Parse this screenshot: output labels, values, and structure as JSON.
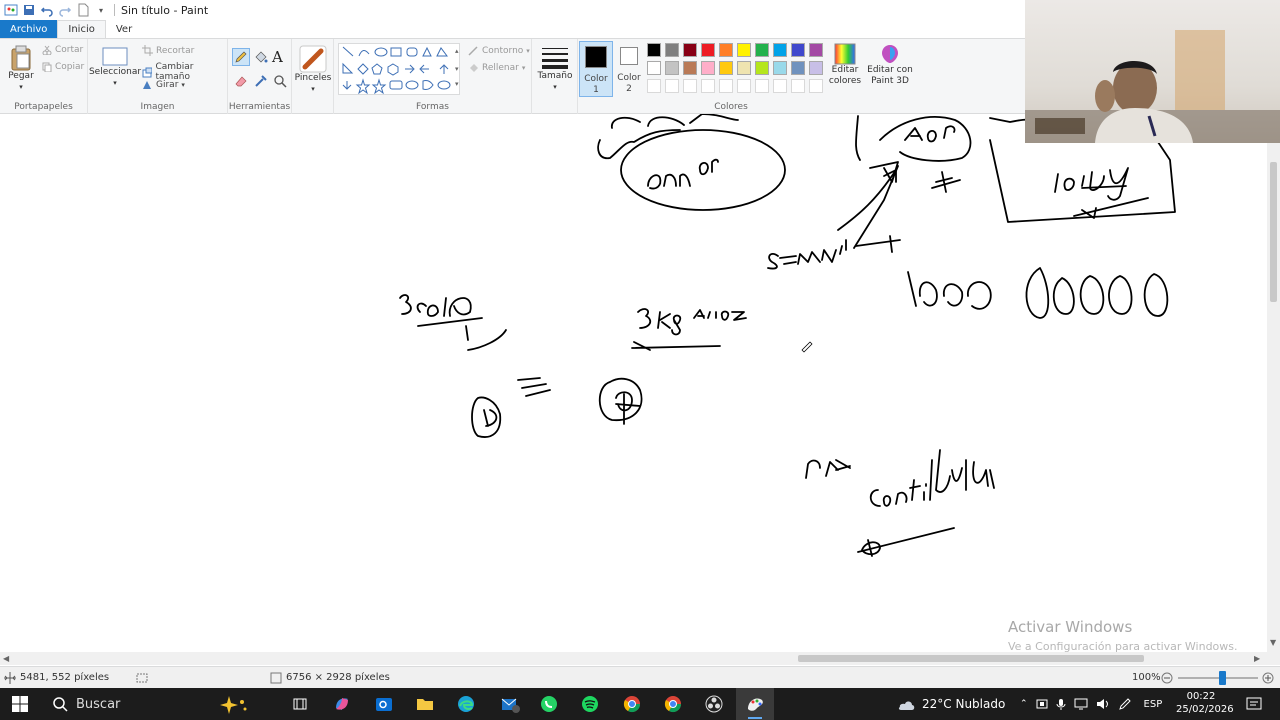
{
  "window": {
    "title": "Sin título - Paint"
  },
  "tabs": [
    {
      "label": "Archivo"
    },
    {
      "label": "Inicio"
    },
    {
      "label": "Ver"
    }
  ],
  "ribbon": {
    "clipboard": {
      "title": "Portapapeles",
      "paste": "Pegar",
      "cut": "Cortar",
      "copy": "Copiar"
    },
    "image": {
      "title": "Imagen",
      "select": "Seleccionar",
      "crop": "Recortar",
      "resize": "Cambiar tamaño",
      "rotate": "Girar"
    },
    "tools": {
      "title": "Herramientas"
    },
    "brushes": {
      "label": "Pinceles"
    },
    "shapes": {
      "title": "Formas",
      "outline": "Contorno",
      "fill": "Rellenar"
    },
    "size": {
      "label": "Tamaño"
    },
    "color1": {
      "label": "Color",
      "sub": "1"
    },
    "color2": {
      "label": "Color",
      "sub": "2"
    },
    "colors": {
      "title": "Colores",
      "edit": "Editar colores",
      "paint3d": "Editar con Paint 3D",
      "row1": [
        "#000000",
        "#7f7f7f",
        "#880015",
        "#ed1c24",
        "#ff7f27",
        "#fff200",
        "#22b14c",
        "#00a2e8",
        "#3f48cc",
        "#a349a4"
      ],
      "row2": [
        "#ffffff",
        "#c3c3c3",
        "#b97a57",
        "#ffaec9",
        "#ffc90e",
        "#efe4b0",
        "#b5e61d",
        "#99d9ea",
        "#7092be",
        "#c8bfe7"
      ]
    }
  },
  "canvas": {
    "watermark_title": "Activar Windows",
    "watermark_sub": "Ve a Configuración para activar Windows."
  },
  "status": {
    "position": "5481, 552 píxeles",
    "size": "6756 × 2928 píxeles",
    "zoom": "100%",
    "zoom_level": 0.5
  },
  "taskbar": {
    "search": "Buscar",
    "weather": "22°C  Nublado",
    "lang": "ESP",
    "time": "00:22",
    "date": "25/02/2026"
  }
}
